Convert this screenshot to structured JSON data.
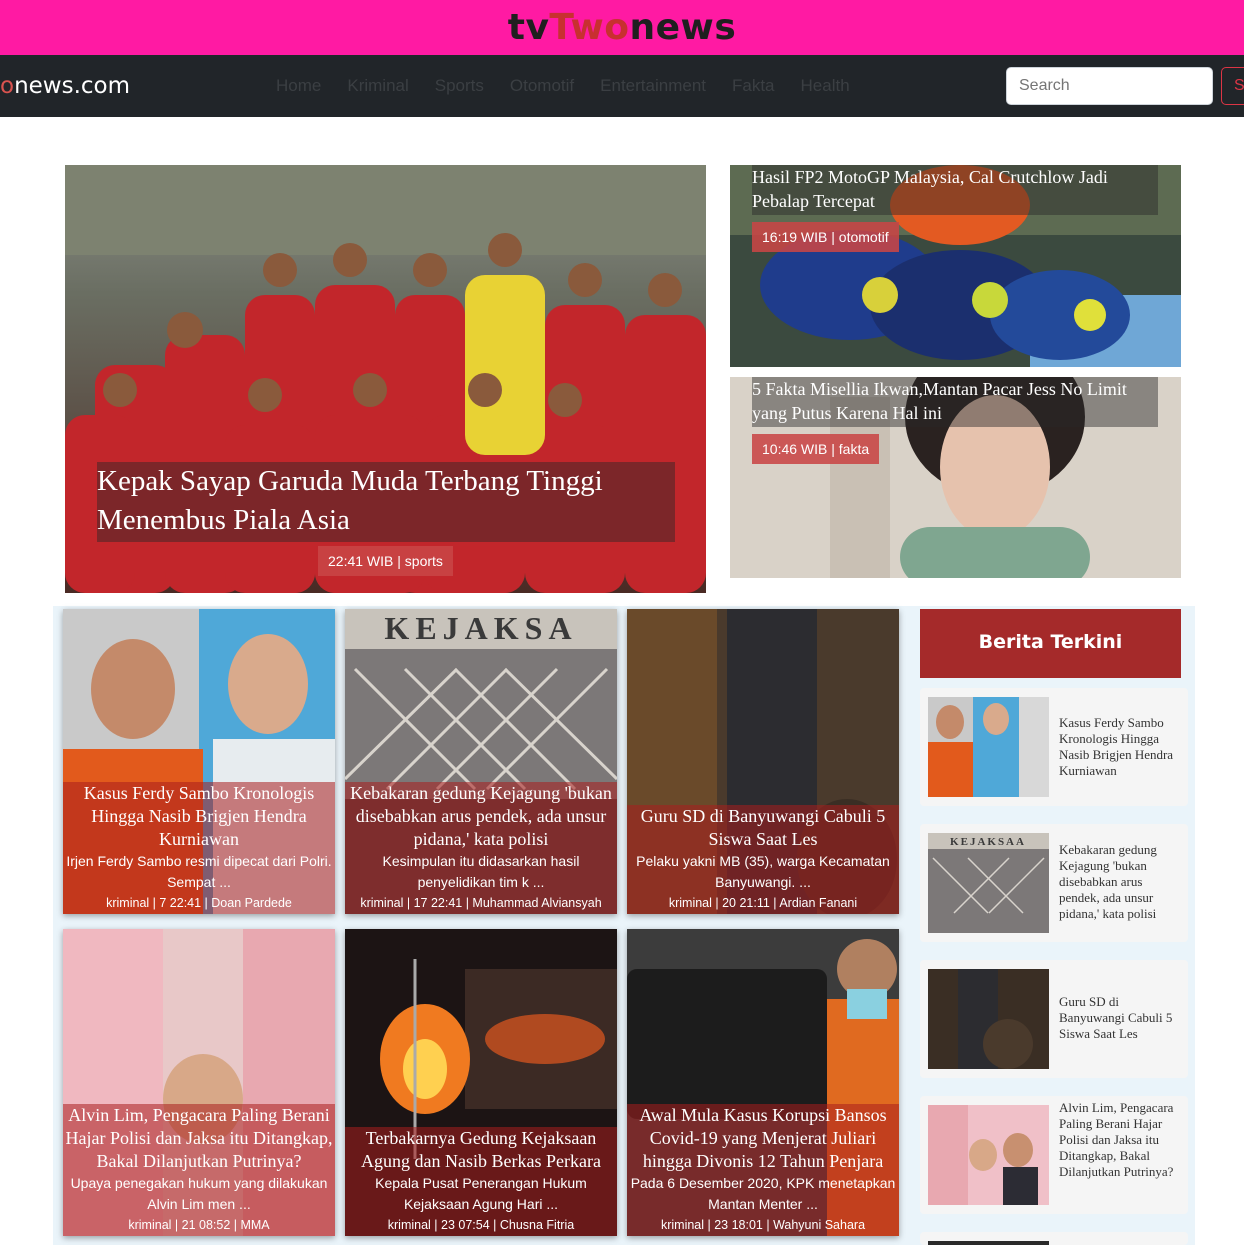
{
  "site": {
    "title_part1": "tv",
    "title_part2": "Two",
    "title_part3": "news",
    "brand_o": "o",
    "brand_rest": "news.com"
  },
  "nav": {
    "links": [
      "Home",
      "Kriminal",
      "Sports",
      "Otomotif",
      "Entertainment",
      "Fakta",
      "Health"
    ],
    "search_placeholder": "Search",
    "search_button": "Search"
  },
  "hero": {
    "main": {
      "title": "Kepak Sayap Garuda Muda Terbang Tinggi Menembus Piala Asia",
      "meta": "22:41 WIB | sports"
    },
    "top_right": {
      "title": "Hasil FP2 MotoGP Malaysia, Cal Crutchlow Jadi Pebalap Tercepat",
      "meta": "16:19 WIB | otomotif"
    },
    "bottom_right": {
      "title": "5 Fakta Misellia Ikwan,Mantan Pacar Jess No Limit yang Putus Karena Hal ini",
      "meta": "10:46 WIB | fakta"
    }
  },
  "cards": [
    {
      "title": "Kasus Ferdy Sambo Kronologis Hingga Nasib Brigjen Hendra Kurniawan",
      "desc": "Irjen Ferdy Sambo resmi dipecat dari Polri. Sempat ...",
      "meta": "kriminal | 7 22:41 | Doan Pardede"
    },
    {
      "title": "Kebakaran gedung Kejagung 'bukan disebabkan arus pendek, ada unsur pidana,' kata polisi",
      "desc": "Kesimpulan itu didasarkan hasil penyelidikan tim k ...",
      "meta": "kriminal | 17 22:41 | Muhammad Alviansyah"
    },
    {
      "title": "Guru SD di Banyuwangi Cabuli 5 Siswa Saat Les",
      "desc": "Pelaku yakni MB (35), warga Kecamatan Banyuwangi. ...",
      "meta": "kriminal | 20 21:11 | Ardian Fanani"
    },
    {
      "title": "Alvin Lim, Pengacara Paling Berani Hajar Polisi dan Jaksa itu Ditangkap, Bakal Dilanjutkan Putrinya?",
      "desc": "Upaya penegakan hukum yang dilakukan Alvin Lim men ...",
      "meta": "kriminal | 21 08:52 | MMA"
    },
    {
      "title": "Terbakarnya Gedung Kejaksaan Agung dan Nasib Berkas Perkara",
      "desc": "Kepala Pusat Penerangan Hukum Kejaksaan Agung Hari ...",
      "meta": "kriminal | 23 07:54 | Chusna Fitria"
    },
    {
      "title": "Awal Mula Kasus Korupsi Bansos Covid-19 yang Menjerat Juliari hingga Divonis 12 Tahun Penjara",
      "desc": "Pada 6 Desember 2020, KPK menetapkan Mantan Menter ...",
      "meta": "kriminal | 23 18:01 | Wahyuni Sahara"
    }
  ],
  "sidebar": {
    "header": "Berita Terkini",
    "items": [
      "Kasus Ferdy Sambo Kronologis Hingga Nasib Brigjen Hendra Kurniawan",
      "Kebakaran gedung Kejagung 'bukan disebabkan arus pendek, ada unsur pidana,' kata polisi",
      "Guru SD di Banyuwangi Cabuli 5 Siswa Saat Les",
      "Alvin Lim, Pengacara Paling Berani Hajar Polisi dan Jaksa itu Ditangkap, Bakal Dilanjutkan Putrinya?"
    ]
  },
  "image_text": {
    "kejaksaan_sign": "KEJAKSA",
    "kejaksaan_sign_small": "KEJAKSAA"
  },
  "colors": {
    "topbar": "#ff1aa3",
    "navbar": "#212529",
    "accent": "#a52a2a",
    "badge": "#c84646"
  }
}
